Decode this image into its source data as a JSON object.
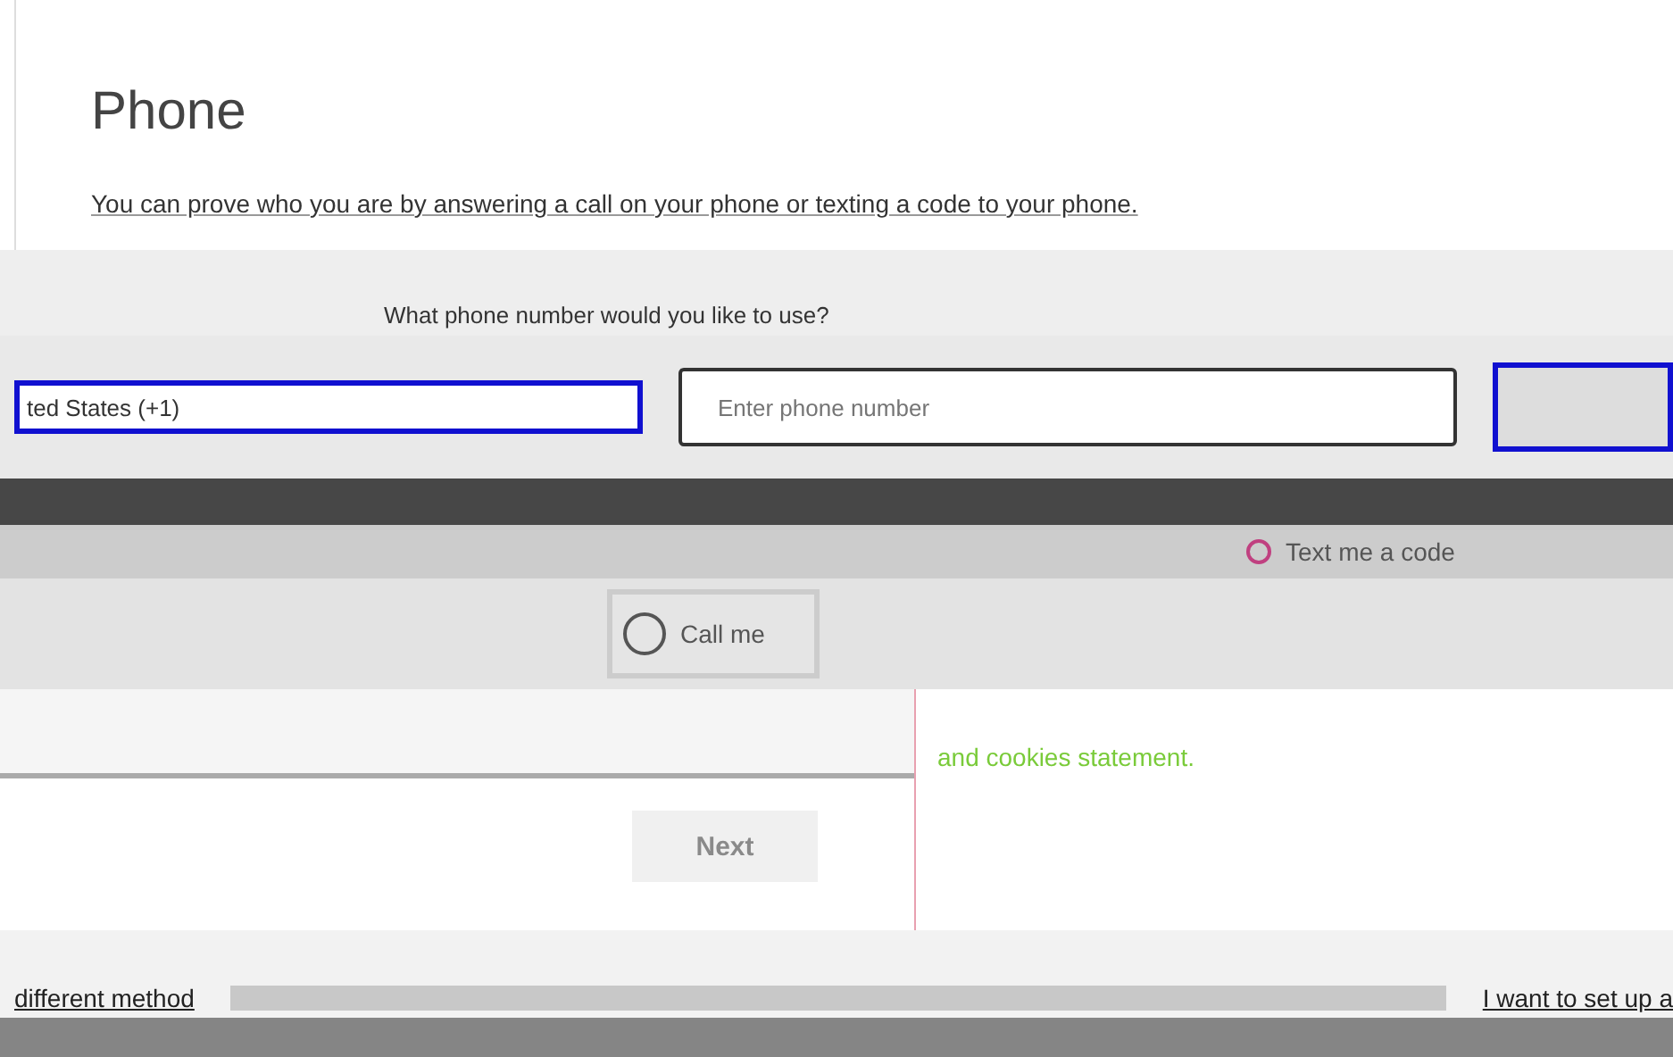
{
  "title": "Phone",
  "description": "You can prove who you are by answering a call on your phone or texting a code to your phone.",
  "question": "What phone number would you like to use?",
  "country": {
    "value": "ted States (+1)"
  },
  "phone": {
    "placeholder": "Enter phone number"
  },
  "methods": [
    {
      "label": "Text me a code",
      "selected": false
    },
    {
      "label": "Call me",
      "selected": false
    }
  ],
  "consent": "and cookies statement.",
  "next": {
    "label": "Next",
    "disabled": true
  },
  "links": [
    "different method",
    "I want to set up a"
  ]
}
